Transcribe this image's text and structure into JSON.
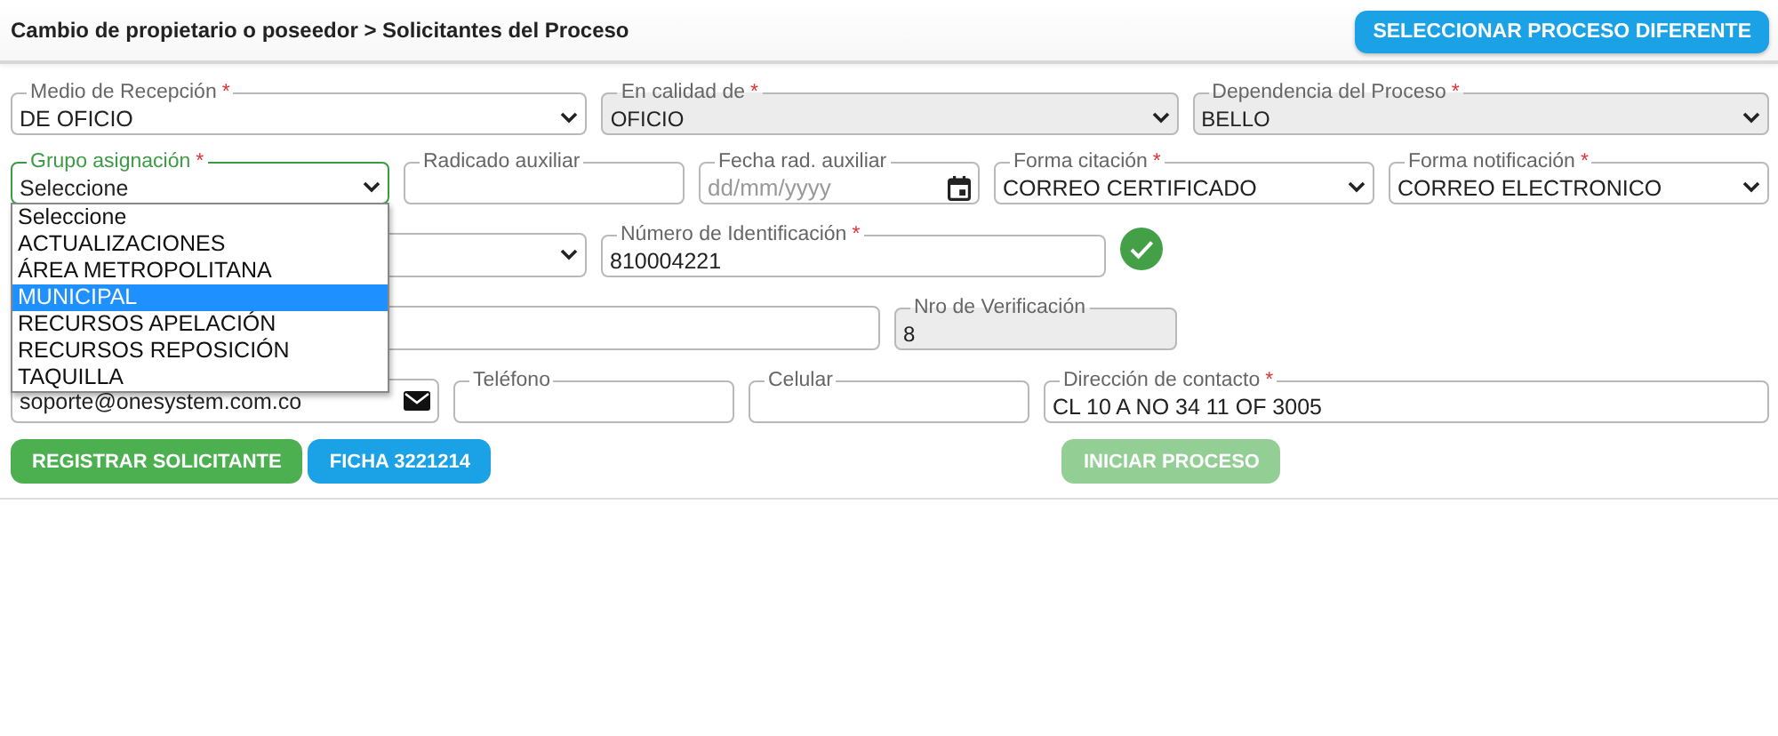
{
  "header": {
    "breadcrumb": "Cambio de propietario o poseedor > Solicitantes del Proceso",
    "button": "SELECCIONAR PROCESO DIFERENTE"
  },
  "rows": [
    [
      {
        "kind": "select",
        "label": "Medio de Recepción",
        "required": true,
        "value": "DE OFICIO",
        "disabled": false,
        "focused": false
      },
      {
        "kind": "select",
        "label": "En calidad de",
        "required": true,
        "value": "OFICIO",
        "disabled": true,
        "focused": false
      },
      {
        "kind": "select",
        "label": "Dependencia del Proceso",
        "required": true,
        "value": "BELLO",
        "disabled": true,
        "focused": false
      }
    ],
    [
      {
        "kind": "select",
        "label": "Grupo asignación",
        "required": true,
        "value": "Seleccione",
        "disabled": false,
        "focused": true
      },
      {
        "kind": "input",
        "label": "Radicado auxiliar",
        "required": false,
        "disabled": false,
        "focused": false
      },
      {
        "kind": "date",
        "label": "Fecha rad. auxiliar",
        "required": false,
        "placeholder": "dd/mm/yyyy",
        "disabled": false,
        "focused": false
      },
      {
        "kind": "select",
        "label": "Forma citación",
        "required": true,
        "value": "CORREO CERTIFICADO",
        "disabled": false,
        "focused": false
      },
      {
        "kind": "select",
        "label": "Forma notificación",
        "required": true,
        "value": "CORREO ELECTRONICO",
        "disabled": false,
        "focused": false
      }
    ],
    [
      {
        "kind": "select",
        "disabled": false,
        "focused": false
      },
      {
        "kind": "input",
        "label": "Número de Identificación",
        "required": true,
        "value": "810004221",
        "disabled": false,
        "focused": false,
        "verified": true
      }
    ],
    [
      {
        "kind": "input",
        "disabled": false,
        "focused": false
      },
      {
        "kind": "input",
        "label": "Nro de Verificación",
        "required": false,
        "value": "8",
        "disabled": true,
        "focused": false
      }
    ],
    [
      {
        "kind": "email",
        "value": "soporte@onesystem.com.co",
        "disabled": false,
        "focused": false
      },
      {
        "kind": "input",
        "label": "Teléfono",
        "required": false,
        "disabled": false,
        "focused": false
      },
      {
        "kind": "input",
        "label": "Celular",
        "required": false,
        "disabled": false,
        "focused": false
      },
      {
        "kind": "input",
        "label": "Dirección de contacto",
        "required": true,
        "value": "CL 10 A NO 34 11 OF 3005",
        "disabled": false,
        "focused": false
      }
    ]
  ],
  "dropdown": {
    "options": [
      {
        "label": "Seleccione",
        "selected": false
      },
      {
        "label": "ACTUALIZACIONES",
        "selected": false
      },
      {
        "label": "ÁREA METROPOLITANA",
        "selected": false
      },
      {
        "label": "MUNICIPAL",
        "selected": true
      },
      {
        "label": "RECURSOS APELACIÓN",
        "selected": false
      },
      {
        "label": "RECURSOS REPOSICIÓN",
        "selected": false
      },
      {
        "label": "TAQUILLA",
        "selected": false
      }
    ]
  },
  "asterisk": "*",
  "buttons": [
    {
      "label": "REGISTRAR SOLICITANTE",
      "kind": "confirm",
      "disabled": false
    },
    {
      "label": "FICHA 3221214",
      "kind": "info",
      "disabled": false
    },
    {
      "label": "INICIAR PROCESO",
      "kind": "confirm",
      "disabled": true
    }
  ]
}
